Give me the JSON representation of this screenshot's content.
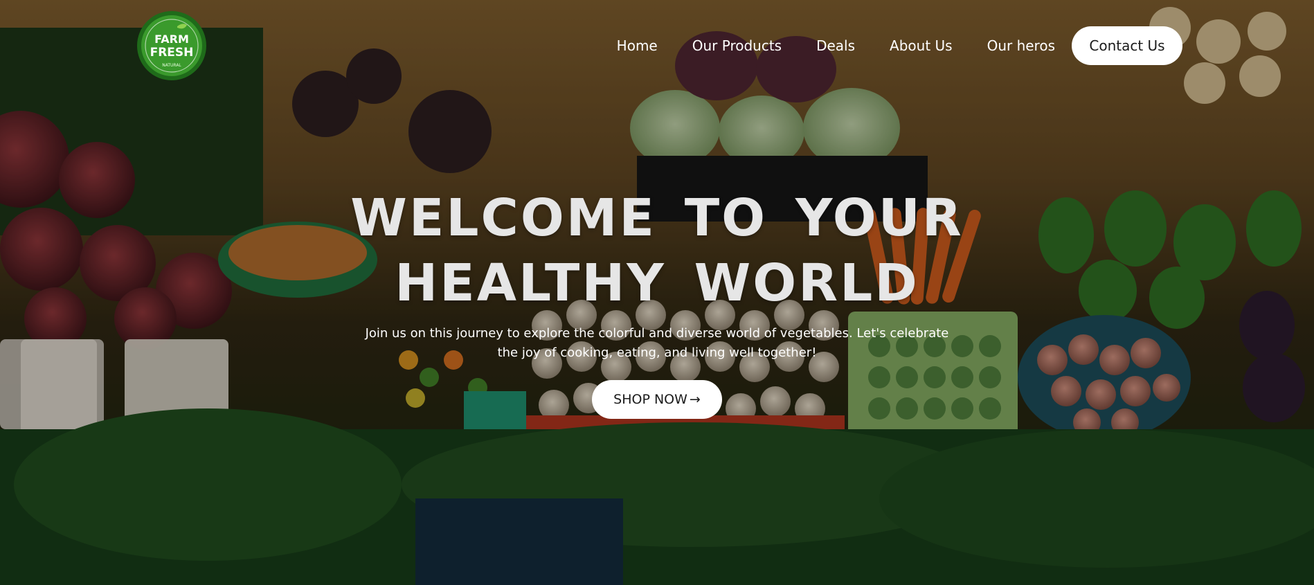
{
  "brand": {
    "logo_line1": "FARM",
    "logo_line2": "FRESH",
    "logo_tag": "NATURAL",
    "colors": {
      "logo_green": "#3a9a2c",
      "logo_dark": "#1f6b1a"
    }
  },
  "nav": {
    "items": [
      {
        "label": "Home"
      },
      {
        "label": "Our Products"
      },
      {
        "label": "Deals"
      },
      {
        "label": "About Us"
      },
      {
        "label": "Our heros"
      }
    ],
    "contact_label": "Contact Us"
  },
  "hero": {
    "title_line1": "WELCOME TO YOUR",
    "title_line2": "HEALTHY WORLD",
    "subtitle": "Join us on this journey to explore the colorful and diverse world of vegetables. Let's celebrate the joy of cooking, eating, and living well together!",
    "cta_label": "SHOP NOW",
    "cta_icon": "arrow-right-icon",
    "background": "market-vegetables-photo"
  }
}
